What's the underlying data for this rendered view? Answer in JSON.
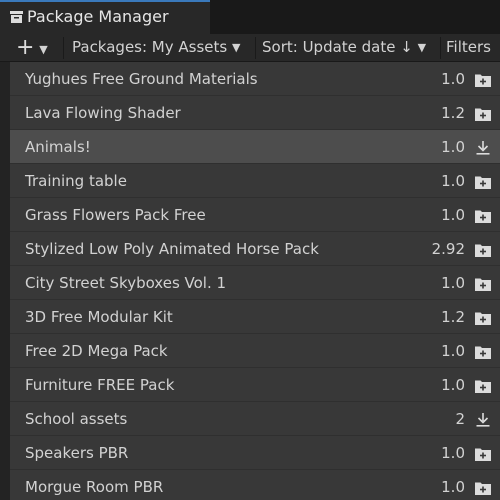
{
  "tab": {
    "title": "Package Manager",
    "icon": "package-manager-icon"
  },
  "toolbar": {
    "add_label": "+",
    "add_caret": "▼",
    "packages_label": "Packages: My Assets",
    "packages_caret": "▼",
    "sort_label": "Sort: Update date ↓",
    "sort_caret": "▼",
    "filters_label": "Filters"
  },
  "packages": [
    {
      "name": "Yughues Free Ground Materials",
      "version": "1.0",
      "icon": "import-folder-icon"
    },
    {
      "name": "Lava Flowing Shader",
      "version": "1.2",
      "icon": "import-folder-icon"
    },
    {
      "name": "Animals!",
      "version": "1.0",
      "icon": "download-icon"
    },
    {
      "name": "Training table",
      "version": "1.0",
      "icon": "import-folder-icon"
    },
    {
      "name": "Grass Flowers Pack Free",
      "version": "1.0",
      "icon": "import-folder-icon"
    },
    {
      "name": "Stylized Low Poly Animated Horse Pack",
      "version": "2.92",
      "icon": "import-folder-icon"
    },
    {
      "name": "City Street Skyboxes Vol. 1",
      "version": "1.0",
      "icon": "import-folder-icon"
    },
    {
      "name": "3D Free Modular Kit",
      "version": "1.2",
      "icon": "import-folder-icon"
    },
    {
      "name": "Free 2D Mega Pack",
      "version": "1.0",
      "icon": "import-folder-icon"
    },
    {
      "name": "Furniture FREE Pack",
      "version": "1.0",
      "icon": "import-folder-icon"
    },
    {
      "name": "School assets",
      "version": "2",
      "icon": "download-icon"
    },
    {
      "name": "Speakers PBR",
      "version": "1.0",
      "icon": "import-folder-icon"
    },
    {
      "name": "Morgue Room PBR",
      "version": "1.0",
      "icon": "import-folder-icon"
    }
  ],
  "selected_index": 2,
  "colors": {
    "accent": "#3a79bb",
    "row_bg": "#383838",
    "row_selected_bg": "#4d4d4d",
    "text": "#d2d2d2"
  }
}
